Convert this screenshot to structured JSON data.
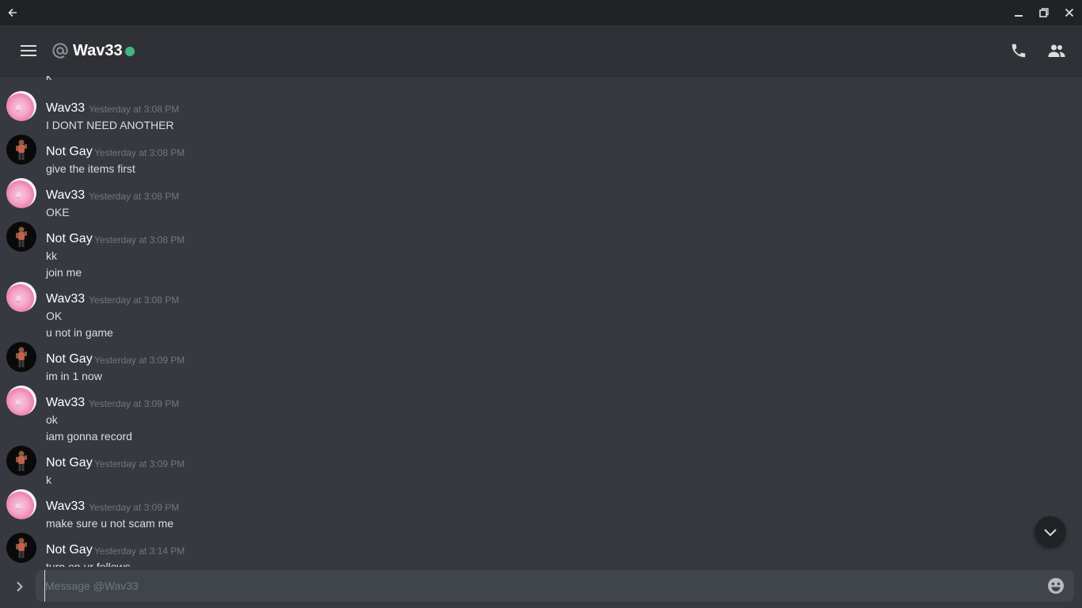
{
  "window": {
    "back_icon": "arrow-left-icon",
    "minimize_icon": "minimize-icon",
    "maximize_icon": "restore-icon",
    "close_icon": "close-icon"
  },
  "header": {
    "menu_icon": "hamburger-icon",
    "channel_icon": "at-icon",
    "name": "Wav33",
    "status": "online",
    "status_color": "#43b581",
    "call_icon": "phone-icon",
    "members_icon": "members-icon"
  },
  "partial_top": {
    "text": "k"
  },
  "messages": [
    {
      "author": "Wav33",
      "timestamp": "Yesterday at 3:08 PM",
      "lines": [
        "I DONT NEED ANOTHER"
      ]
    },
    {
      "author": "Not Gay",
      "timestamp": "Yesterday at 3:08 PM",
      "lines": [
        "give the items first"
      ]
    },
    {
      "author": "Wav33",
      "timestamp": "Yesterday at 3:08 PM",
      "lines": [
        "OKE"
      ]
    },
    {
      "author": "Not Gay",
      "timestamp": "Yesterday at 3:08 PM",
      "lines": [
        "kk",
        "join me"
      ]
    },
    {
      "author": "Wav33",
      "timestamp": "Yesterday at 3:08 PM",
      "lines": [
        "OK",
        "u not in game"
      ]
    },
    {
      "author": "Not Gay",
      "timestamp": "Yesterday at 3:09 PM",
      "lines": [
        "im in 1 now"
      ]
    },
    {
      "author": "Wav33",
      "timestamp": "Yesterday at 3:09 PM",
      "lines": [
        "ok",
        "iam gonna record"
      ]
    },
    {
      "author": "Not Gay",
      "timestamp": "Yesterday at 3:09 PM",
      "lines": [
        "k"
      ]
    },
    {
      "author": "Wav33",
      "timestamp": "Yesterday at 3:09 PM",
      "lines": [
        "make sure u not scam me"
      ]
    },
    {
      "author": "Not Gay",
      "timestamp": "Yesterday at 3:14 PM",
      "lines": [
        "turn on ur follows"
      ]
    }
  ],
  "jump_icon": "chevron-down-icon",
  "composer": {
    "expand_icon": "chevron-right-icon",
    "placeholder": "Message @Wav33",
    "value": "",
    "emoji_icon": "emoji-icon"
  },
  "colors": {
    "background": "#36393f",
    "header": "#2f3136",
    "titlebar": "#202225",
    "input": "#40444b",
    "timestamp": "#72767d"
  }
}
